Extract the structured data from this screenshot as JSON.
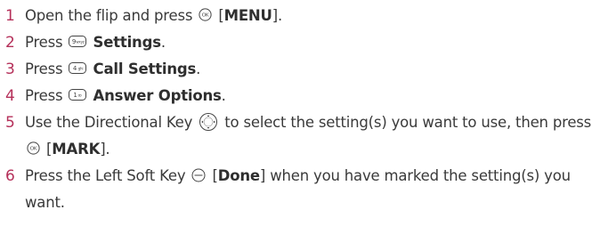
{
  "steps": [
    {
      "num": "1",
      "pre": "Open the flip and press",
      "key": "ok-key-icon",
      "post_open": "[",
      "bold": "MENU",
      "post_close": "]."
    },
    {
      "num": "2",
      "pre": "Press",
      "key": "key-9-icon",
      "bold": "Settings",
      "post": "."
    },
    {
      "num": "3",
      "pre": "Press",
      "key": "key-4-icon",
      "bold": "Call Settings",
      "post": "."
    },
    {
      "num": "4",
      "pre": "Press",
      "key": "key-1-icon",
      "bold": "Answer Options",
      "post": "."
    },
    {
      "num": "5",
      "pre": "Use the Directional Key",
      "key": "directional-key-icon",
      "mid": "to select the setting(s) you want to use, then press",
      "key2": "ok-key-icon",
      "post_open": "[",
      "bold": "MARK",
      "post_close": "]."
    },
    {
      "num": "6",
      "pre": "Press the Left Soft Key",
      "key": "left-soft-key-icon",
      "post_open": "[",
      "bold": "Done",
      "post_close": "] when you have marked the setting(s) you want."
    }
  ],
  "colors": {
    "number": "#b5305a",
    "text": "#3a3a3a"
  }
}
